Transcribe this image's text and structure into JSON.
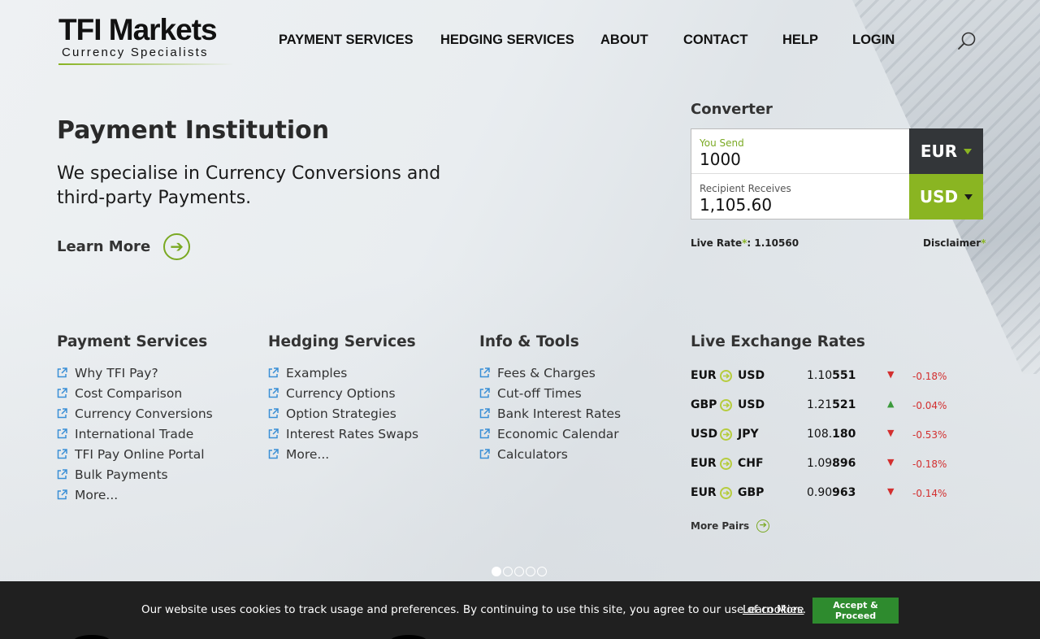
{
  "header": {
    "logo_main": "TFI Markets",
    "logo_sub": "Currency Specialists",
    "nav": [
      {
        "label": "PAYMENT SERVICES"
      },
      {
        "label": "HEDGING SERVICES"
      },
      {
        "label": "ABOUT"
      },
      {
        "label": "CONTACT"
      },
      {
        "label": "HELP"
      },
      {
        "label": "LOGIN"
      }
    ]
  },
  "hero": {
    "title": "Payment Institution",
    "text": "We specialise in Currency Conversions and third-party Payments.",
    "learn_more": "Learn More"
  },
  "converter": {
    "title": "Converter",
    "send_label": "You Send",
    "send_value": "1000",
    "send_currency": "EUR",
    "receive_label": "Recipient Receives",
    "receive_value": "1,105.60",
    "receive_currency": "USD",
    "live_rate_label": "Live Rate",
    "live_rate_star": "*",
    "live_rate_value": ": 1.10560",
    "disclaimer": "Disclaimer",
    "disclaimer_star": "*"
  },
  "columns": [
    {
      "title": "Payment Services",
      "links": [
        "Why TFI Pay?",
        "Cost Comparison",
        "Currency Conversions",
        "International Trade",
        "TFI Pay Online Portal",
        "Bulk Payments",
        "More..."
      ]
    },
    {
      "title": "Hedging Services",
      "links": [
        "Examples",
        "Currency Options",
        "Option Strategies",
        "Interest Rates Swaps",
        "More..."
      ]
    },
    {
      "title": "Info & Tools",
      "links": [
        "Fees & Charges",
        "Cut-off Times",
        "Bank Interest Rates",
        "Economic Calendar",
        "Calculators"
      ]
    }
  ],
  "rates": {
    "title": "Live Exchange Rates",
    "rows": [
      {
        "from": "EUR",
        "to": "USD",
        "rate_main": "1.10",
        "rate_bold": "551",
        "direction": "down",
        "change": "-0.18%"
      },
      {
        "from": "GBP",
        "to": "USD",
        "rate_main": "1.21",
        "rate_bold": "521",
        "direction": "up",
        "change": "-0.04%"
      },
      {
        "from": "USD",
        "to": "JPY",
        "rate_main": "108.",
        "rate_bold": "180",
        "direction": "down",
        "change": "-0.53%"
      },
      {
        "from": "EUR",
        "to": "CHF",
        "rate_main": "1.09",
        "rate_bold": "896",
        "direction": "down",
        "change": "-0.18%"
      },
      {
        "from": "EUR",
        "to": "GBP",
        "rate_main": "0.90",
        "rate_bold": "963",
        "direction": "down",
        "change": "-0.14%"
      }
    ],
    "more_pairs": "More Pairs"
  },
  "slider": {
    "count": 5,
    "active": 0
  },
  "cookie": {
    "text": "Our website uses cookies to track usage and preferences. By continuing to use this site, you agree to our use of cookies.",
    "link": "Learn More",
    "button": "Accept & Proceed"
  },
  "colors": {
    "accent_green": "#8ab522",
    "dark_button": "#333639",
    "cookie_bg": "#202020",
    "accept_button": "#2e8b2e",
    "rate_down": "#d32f2f",
    "rate_up": "#3c9a3c",
    "link_icon": "#3a8fd6"
  },
  "icons": {
    "search": "search-icon",
    "external_link": "external-link-icon",
    "pair_arrow": "exchange-arrow-icon",
    "learn_more": "circle-arrow-right-icon"
  }
}
